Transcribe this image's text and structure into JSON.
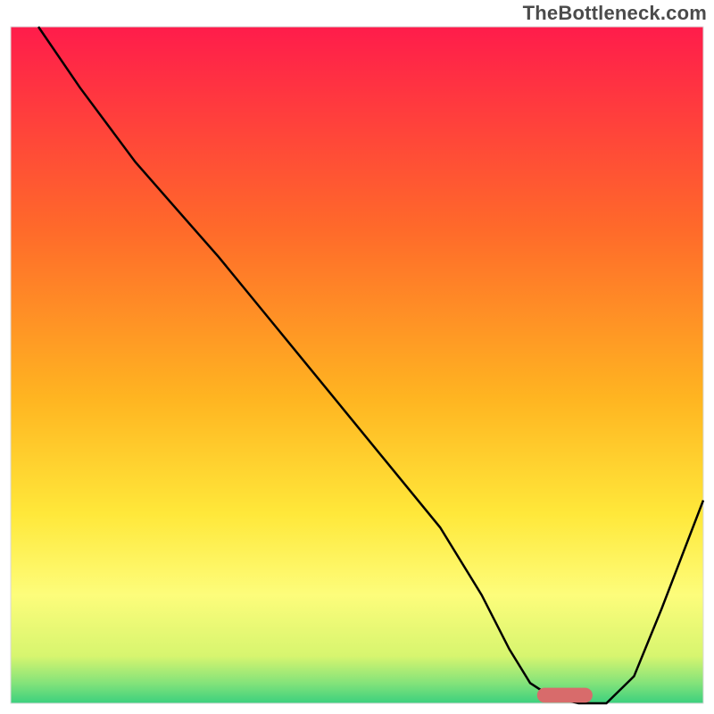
{
  "watermark": "TheBottleneck.com",
  "chart_data": {
    "type": "line",
    "title": "",
    "xlabel": "",
    "ylabel": "",
    "xlim": [
      0,
      100
    ],
    "ylim": [
      0,
      100
    ],
    "grid": false,
    "background_gradient_stops": [
      {
        "offset": 0.0,
        "color": "#ff1c4b"
      },
      {
        "offset": 0.3,
        "color": "#ff6a2a"
      },
      {
        "offset": 0.55,
        "color": "#ffb521"
      },
      {
        "offset": 0.72,
        "color": "#ffe83a"
      },
      {
        "offset": 0.84,
        "color": "#fdfd7b"
      },
      {
        "offset": 0.93,
        "color": "#d7f56f"
      },
      {
        "offset": 0.97,
        "color": "#84e37a"
      },
      {
        "offset": 1.0,
        "color": "#3bd07e"
      }
    ],
    "series": [
      {
        "name": "bottleneck-curve",
        "stroke": "#000000",
        "stroke_width": 2.5,
        "fill": "none",
        "x": [
          4,
          10,
          18,
          24,
          30,
          38,
          46,
          54,
          62,
          68,
          72,
          75,
          78,
          82,
          86,
          90,
          94,
          100
        ],
        "values": [
          100,
          91,
          80,
          73,
          66,
          56,
          46,
          36,
          26,
          16,
          8,
          3,
          1,
          0,
          0,
          4,
          14,
          30
        ]
      }
    ],
    "marker": {
      "name": "optimal-range",
      "shape": "pill",
      "x_center": 80,
      "y_center": 1.2,
      "width": 8,
      "height": 2.2,
      "fill": "#d86b6b"
    },
    "bottleneck_domain_x": [
      0,
      100
    ],
    "optimal_x_range": [
      76,
      84
    ],
    "approx_optimal_x": 80
  }
}
